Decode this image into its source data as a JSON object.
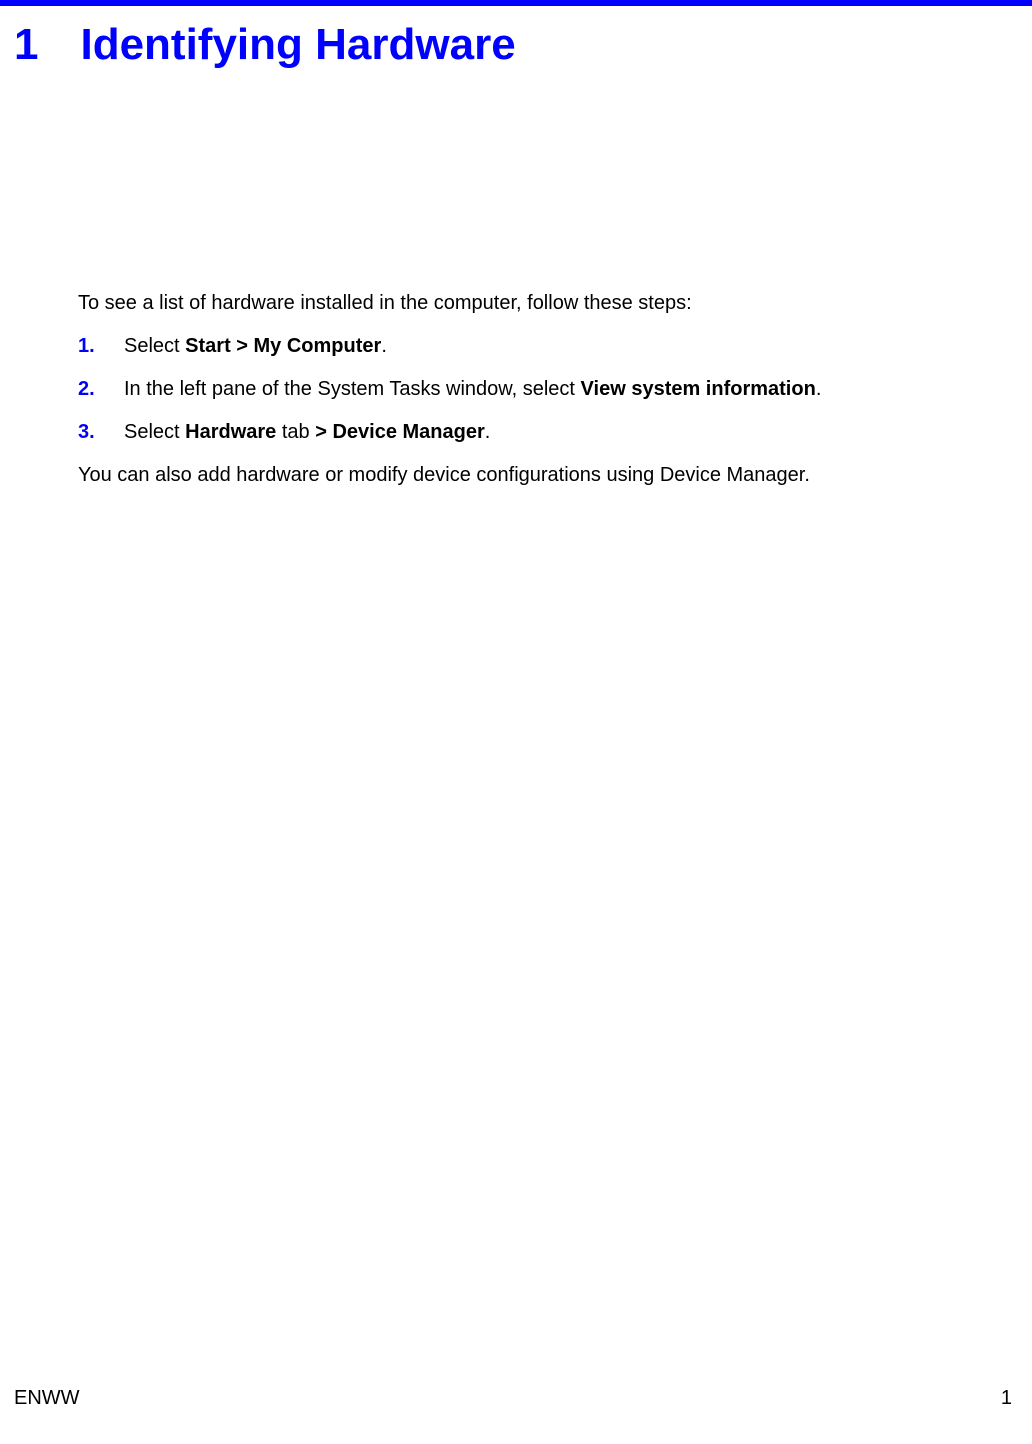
{
  "chapter": {
    "number": "1",
    "title": "Identifying Hardware"
  },
  "intro": "To see a list of hardware installed in the computer, follow these steps:",
  "steps": [
    {
      "number": "1.",
      "pre": "Select ",
      "bold": "Start > My Computer",
      "post": "."
    },
    {
      "number": "2.",
      "pre": "In the left pane of the System Tasks window, select ",
      "bold": "View system information",
      "post": "."
    },
    {
      "number": "3.",
      "pre": "Select ",
      "bold": "Hardware",
      "mid": " tab ",
      "bold2": "> Device Manager",
      "post": "."
    }
  ],
  "closing": "You can also add hardware or modify device configurations using Device Manager.",
  "footer": {
    "left": "ENWW",
    "right": "1"
  }
}
